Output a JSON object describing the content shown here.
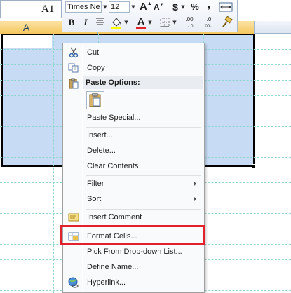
{
  "namebox": {
    "value": "A1"
  },
  "columns": {
    "a": "A"
  },
  "minibar": {
    "font_name": "Times Ne",
    "font_size": "12",
    "grow_font": "A",
    "shrink_font": "A",
    "currency": "$",
    "percent": "%",
    "comma": ",",
    "bold": "B",
    "italic": "I",
    "font_color_glyph": "A",
    "decrease_decimal": ".00",
    "increase_decimal": ".0",
    "accent_color": "#e3212a"
  },
  "menu": {
    "cut": "Cut",
    "copy": "Copy",
    "paste_options_header": "Paste Options:",
    "paste_special": "Paste Special...",
    "insert": "Insert...",
    "delete": "Delete...",
    "clear_contents": "Clear Contents",
    "filter": "Filter",
    "sort": "Sort",
    "insert_comment": "Insert Comment",
    "format_cells": "Format Cells...",
    "pick_from_dropdown": "Pick From Drop-down List...",
    "define_name": "Define Name...",
    "hyperlink": "Hyperlink..."
  },
  "colors": {
    "selection_fill": "#c7dcf4",
    "highlight_border": "#e3212a",
    "gridline": "#8fd7cf",
    "column_header_selected": "#f6c85e"
  }
}
